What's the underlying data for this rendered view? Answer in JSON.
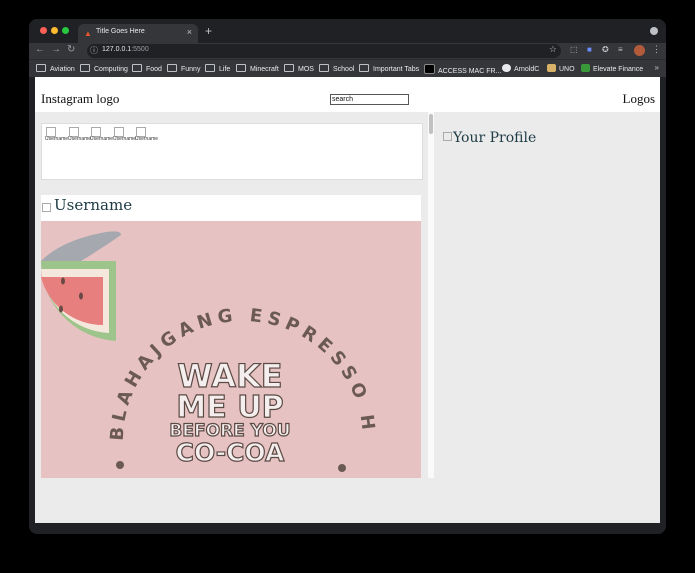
{
  "browser": {
    "tab_title": "Title Goes Here",
    "tab_close": "×",
    "new_tab": "+",
    "url_host": "127.0.0.1",
    "url_port": ":5500",
    "bookmarks": [
      {
        "label": "Aviation"
      },
      {
        "label": "Computing"
      },
      {
        "label": "Food"
      },
      {
        "label": "Funny"
      },
      {
        "label": "Life"
      },
      {
        "label": "Minecraft"
      },
      {
        "label": "MOS"
      },
      {
        "label": "School"
      },
      {
        "label": "Important Tabs"
      },
      {
        "label": "ACCESS MAC FR..."
      },
      {
        "label": "ArnoldC"
      },
      {
        "label": "UNO"
      },
      {
        "label": "Elevate Finance"
      }
    ],
    "bookmarks_more": "»"
  },
  "page": {
    "logo": "Instagram logo",
    "search_value": "search",
    "logos": "Logos",
    "stories": [
      "Username",
      "Username",
      "Username",
      "Username",
      "Username"
    ],
    "post": {
      "username": "Username",
      "image": {
        "arc_text": "BLAHAJGANG ESPRESSO HOUR",
        "line1": "WAKE",
        "line2": "ME UP",
        "line3": "BEFORE YOU",
        "line4": "CO-COA"
      }
    },
    "profile": "Your Profile"
  },
  "colors": {
    "post_bg": "#e7c2c2",
    "arc_text": "#6b5a54",
    "headline_fill": "#f5eeee",
    "headline_stroke": "#5a4a44"
  }
}
